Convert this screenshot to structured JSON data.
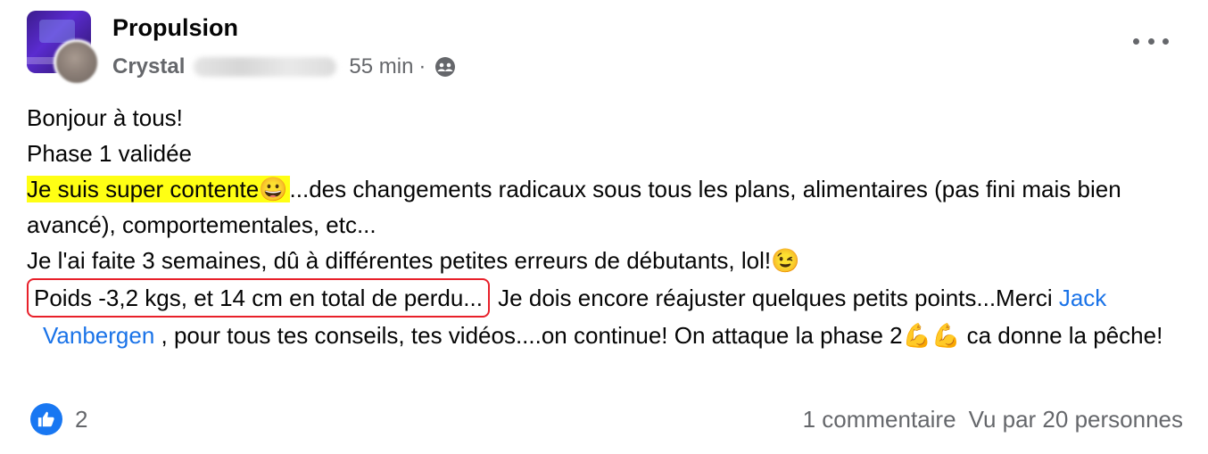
{
  "post": {
    "group_name": "Propulsion",
    "author": "Crystal",
    "time": "55 min",
    "separator": "·",
    "body": {
      "line1": "Bonjour à tous!",
      "line2": "Phase 1 validée",
      "highlighted": "Je suis super contente😀",
      "line3_rest": "...des changements radicaux sous tous les plans, alimentaires (pas fini mais bien avancé), comportementales, etc...",
      "line4": "Je l'ai faite 3 semaines, dû à différentes petites erreurs de débutants, lol!😉",
      "boxed": "Poids -3,2 kgs, et 14 cm en total de perdu...",
      "line5_rest": " Je dois encore réajuster quelques petits points...Merci ",
      "mention": "Jack Vanbergen",
      "line5_end": " , pour tous tes conseils, tes vidéos....on continue! On attaque la phase 2💪💪 ca donne la pêche!"
    },
    "footer": {
      "like_count": "2",
      "comments": "1 commentaire",
      "views": "Vu par 20 personnes"
    },
    "icons": {
      "like": "thumbs-up-icon",
      "privacy": "group-members-icon",
      "more": "more-options-icon"
    },
    "colors": {
      "highlight": "#ffff14",
      "mention": "#1a73e8",
      "box_border": "#e8202a",
      "like_blue": "#1877f2"
    }
  }
}
